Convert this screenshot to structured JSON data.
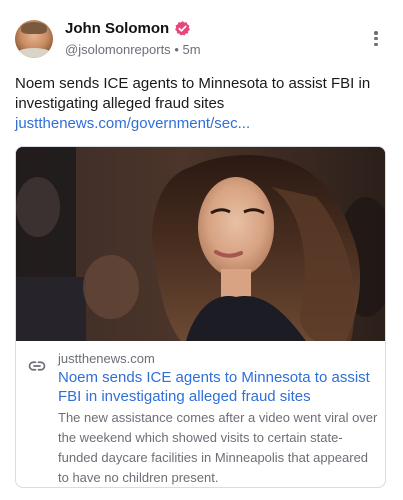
{
  "author": {
    "name": "John Solomon",
    "handle": "@jsolomonreports",
    "separator": "•",
    "time": "5m",
    "verified_color": "#e8457c"
  },
  "post": {
    "text": "Noem sends ICE agents to Minnesota to assist FBI in investigating alleged fraud sites ",
    "link_text": "justthenews.com/government/sec..."
  },
  "link_card": {
    "domain": "justthenews.com",
    "title": "Noem sends ICE agents to Minnesota to assist FBI in investigating alleged fraud sites",
    "description": "The new assistance comes after a video went viral over the weekend which showed visits to certain state-funded daycare facilities in Minneapolis that appeared to have no children present."
  },
  "icons": {
    "verified": "verified-badge-icon",
    "more": "more-options-icon",
    "link": "link-icon"
  },
  "colors": {
    "link": "#2f6fd8",
    "muted": "#6b6f76",
    "border": "#d9dce1"
  }
}
